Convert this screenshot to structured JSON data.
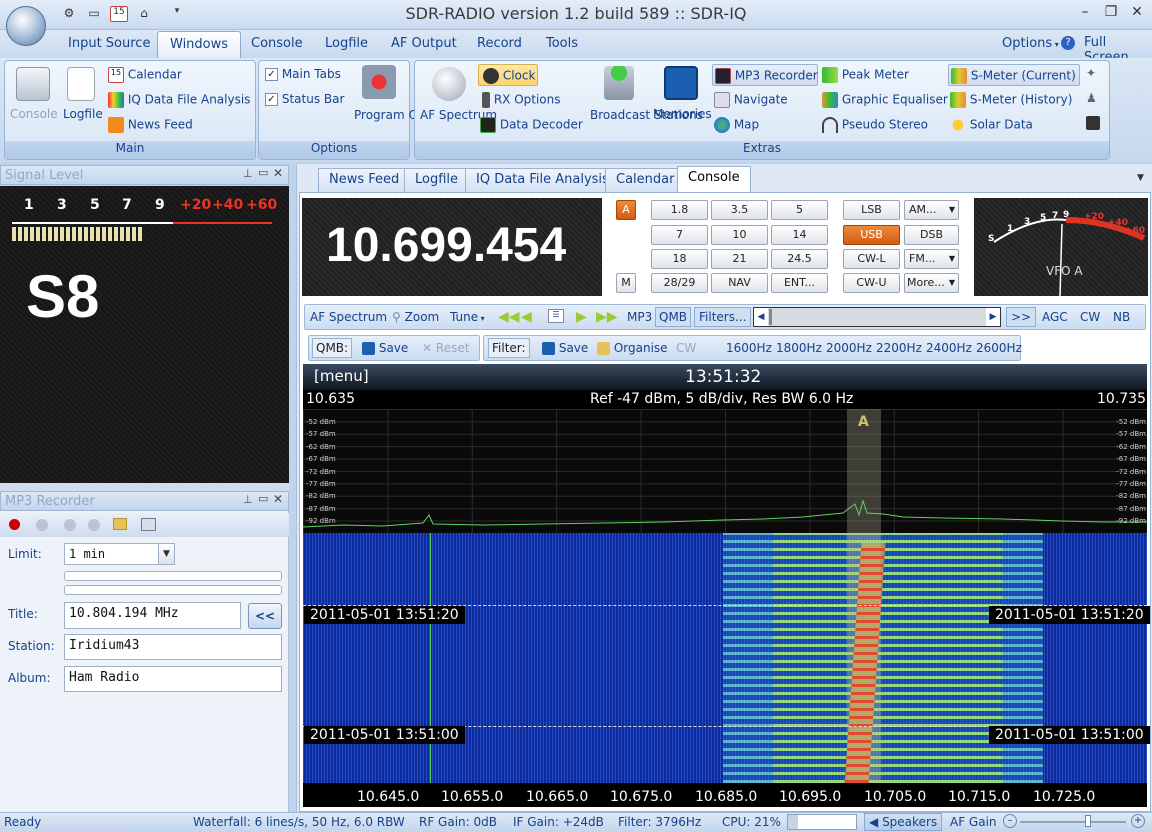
{
  "window": {
    "title": "SDR-RADIO version 1.2  build 589 :: SDR-IQ"
  },
  "menu": {
    "items": [
      "Input Source",
      "Windows",
      "Console",
      "Logfile",
      "AF Output",
      "Record",
      "Tools"
    ],
    "options": "Options",
    "full_screen": "Full Screen"
  },
  "ribbon": {
    "main": {
      "label": "Main",
      "console": "Console",
      "logfile": "Logfile",
      "calendar": "Calendar",
      "iq": "IQ Data File Analysis",
      "news": "News Feed"
    },
    "options": {
      "label": "Options",
      "main_tabs": "Main Tabs",
      "status_bar": "Status Bar",
      "program_options": "Program Options"
    },
    "extras": {
      "label": "Extras",
      "af_spectrum": "AF Spectrum",
      "clock": "Clock",
      "rx_options": "RX Options",
      "data_decoder": "Data Decoder",
      "broadcast": "Broadcast Stations",
      "memories": "Memories",
      "mp3": "MP3 Recorder",
      "navigate": "Navigate",
      "map": "Map",
      "peak": "Peak Meter",
      "geq": "Graphic Equaliser",
      "pseudo": "Pseudo Stereo",
      "smc": "S-Meter (Current)",
      "smh": "S-Meter (History)",
      "solar": "Solar Data"
    }
  },
  "signal": {
    "title": "Signal Level",
    "scale": [
      "1",
      "3",
      "5",
      "7",
      "9",
      "+20",
      "+40",
      "+60"
    ],
    "value": "S8"
  },
  "mp3panel": {
    "title": "MP3 Recorder",
    "limit_label": "Limit:",
    "limit_value": "1 min",
    "title_label": "Title:",
    "title_value": "10.804.194 MHz",
    "back_btn": "<<",
    "station_label": "Station:",
    "station_value": "Iridium43",
    "album_label": "Album:",
    "album_value": "Ham Radio"
  },
  "tabs": [
    "News Feed",
    "Logfile",
    "IQ Data File Analysis",
    "Calendar",
    "Console"
  ],
  "console": {
    "frequency": "10.699.454",
    "a_btn": "A",
    "m_btn": "M",
    "bands": [
      "1.8",
      "3.5",
      "5",
      "7",
      "10",
      "14",
      "18",
      "21",
      "24.5",
      "28/29",
      "NAV",
      "ENT..."
    ],
    "modes": [
      "LSB",
      "AM...",
      "USB",
      "DSB",
      "CW-L",
      "FM...",
      "CW-U",
      "More..."
    ],
    "meter_scale": [
      "S",
      "1",
      "3",
      "5",
      "7",
      "9",
      "+20",
      "+40",
      "+60"
    ],
    "vfo": "VFO A"
  },
  "toolbar1": {
    "af": "AF Spectrum",
    "zoom": "Zoom",
    "tune": "Tune",
    "mp3": "MP3",
    "qmb": "QMB",
    "filters": "Filters...",
    "more": ">>",
    "agc": "AGC",
    "cw": "CW",
    "nb": "NB"
  },
  "toolbar2": {
    "qmb": "QMB:",
    "save": "Save",
    "reset": "Reset",
    "filter": "Filter:",
    "save2": "Save",
    "organise": "Organise",
    "cw": "CW",
    "widths": [
      "1600Hz",
      "1800Hz",
      "2000Hz",
      "2200Hz",
      "2400Hz",
      "2600Hz"
    ]
  },
  "spectrum": {
    "menu": "[menu]",
    "time": "13:51:32",
    "left_freq": "10.635",
    "right_freq": "10.735",
    "info": "Ref -47 dBm,  5 dB/div,  Res BW 6.0 Hz",
    "dbm": [
      "-52 dBm",
      "-57 dBm",
      "-62 dBm",
      "-67 dBm",
      "-72 dBm",
      "-77 dBm",
      "-82 dBm",
      "-87 dBm",
      "-92 dBm"
    ],
    "marker": "A",
    "ts1": "2011-05-01  13:51:20",
    "ts2": "2011-05-01  13:51:00",
    "axis": [
      "10.645.0",
      "10.655.0",
      "10.665.0",
      "10.675.0",
      "10.685.0",
      "10.695.0",
      "10.705.0",
      "10.715.0",
      "10.725.0"
    ]
  },
  "status": {
    "ready": "Ready",
    "waterfall": "Waterfall: 6 lines/s, 50 Hz, 6.0 RBW",
    "rf": "RF Gain: 0dB",
    "if": "IF Gain: +24dB",
    "filter": "Filter: 3796Hz",
    "cpu": "CPU: 21%",
    "speakers": "Speakers",
    "afgain": "AF Gain"
  }
}
